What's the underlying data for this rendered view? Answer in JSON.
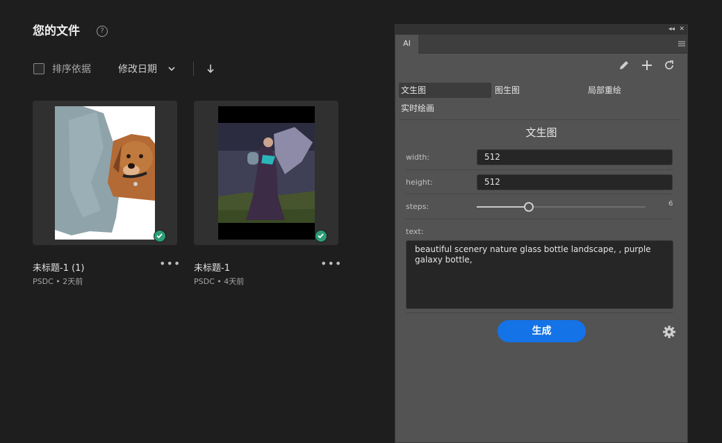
{
  "header": {
    "title": "您的文件",
    "help_glyph": "?"
  },
  "sort": {
    "label": "排序依据",
    "field": "修改日期"
  },
  "files": [
    {
      "name": "未标题-1 (1)",
      "meta": "PSDC • 2天前",
      "more": "•••"
    },
    {
      "name": "未标题-1",
      "meta": "PSDC • 4天前",
      "more": "•••"
    }
  ],
  "panel": {
    "tab": "AI",
    "chrome": {
      "collapse": "◂◂",
      "close": "✕"
    },
    "modes": [
      "文生图",
      "图生图",
      "局部重绘",
      "实时绘画"
    ],
    "active_mode": "文生图",
    "section_title": "文生图",
    "fields": {
      "width_label": "width:",
      "width_value": "512",
      "height_label": "height:",
      "height_value": "512",
      "steps_label": "steps:",
      "steps_value": "6",
      "text_label": "text:",
      "text_value": "beautiful scenery nature glass bottle landscape, , purple galaxy bottle,"
    },
    "steps_fraction": 0.31,
    "generate_label": "生成"
  },
  "colors": {
    "accent": "#1473e6",
    "success": "#2d9d78",
    "panel_bg": "#535353",
    "page_bg": "#1e1e1e"
  }
}
